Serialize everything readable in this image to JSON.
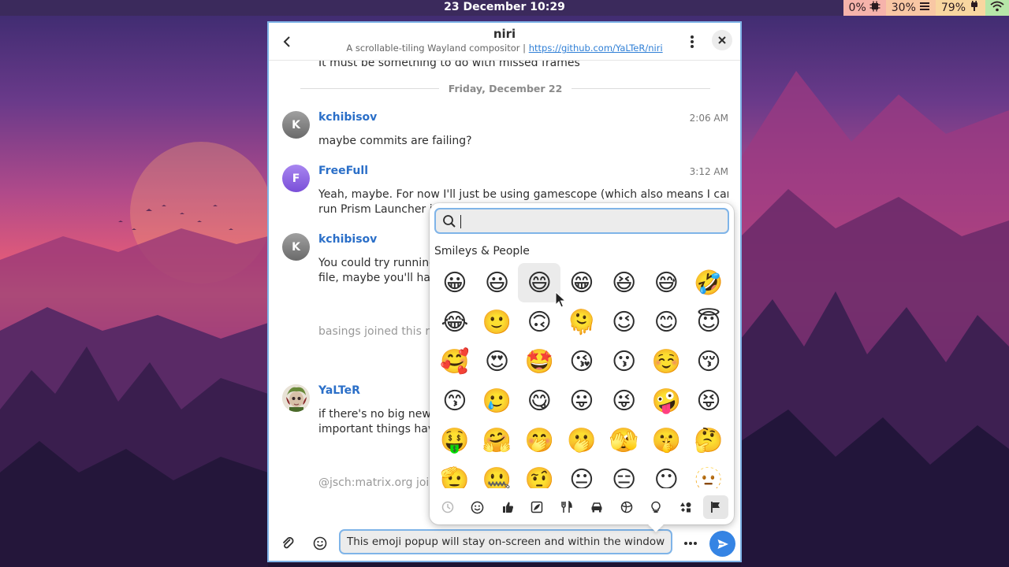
{
  "topbar": {
    "clock": "23 December 10:29",
    "cpu": "0%",
    "memory": "30%",
    "battery": "79%"
  },
  "room": {
    "title": "niri",
    "topic": "A scrollable-tiling Wayland compositor |",
    "topic_link": "https://github.com/YaLTeR/niri"
  },
  "timeline": {
    "prev_message": "It must be something to do with missed frames",
    "day_divider": "Friday, December 22",
    "messages": [
      {
        "sender": "kchibisov",
        "initial": "K",
        "time": "2:06 AM",
        "lines": [
          "maybe commits are failing?"
        ]
      },
      {
        "sender": "FreeFull",
        "initial": "F",
        "time": "3:12 AM",
        "lines": [
          "Yeah, maybe. For now I'll just be using gamescope (which also means I can just",
          "run Prism Launcher its"
        ]
      },
      {
        "sender": "kchibisov",
        "initial": "K",
        "time": "",
        "lines": [
          "You could try running r",
          "file, maybe you'll have"
        ]
      },
      {
        "sender": "YaLTeR",
        "initial": "",
        "time": "",
        "lines": [
          "if there's no big new is",
          "important things have"
        ]
      }
    ],
    "events": [
      "basings joined this roo",
      "@jsch:matrix.org joine"
    ]
  },
  "composer": {
    "value": "This emoji popup will stay on-screen and within the window!"
  },
  "emoji_picker": {
    "search_value": "",
    "section": "Smileys & People",
    "emojis": [
      "😀",
      "😃",
      "😄",
      "😁",
      "😆",
      "😅",
      "🤣",
      "😂",
      "🙂",
      "🙃",
      "🫠",
      "😉",
      "😊",
      "😇",
      "🥰",
      "😍",
      "🤩",
      "😘",
      "😗",
      "☺️",
      "😚",
      "😙",
      "🥲",
      "😋",
      "😛",
      "😜",
      "🤪",
      "😝",
      "🤑",
      "🤗",
      "🤭",
      "🫢",
      "🫣",
      "🤫",
      "🤔",
      "🫡",
      "🤐",
      "🤨",
      "😐",
      "😑",
      "😶",
      "🫥"
    ],
    "categories": [
      "recent-icon",
      "smileys-icon",
      "people-icon",
      "nature-icon",
      "food-icon",
      "travel-icon",
      "activities-icon",
      "objects-icon",
      "symbols-icon",
      "flags-icon"
    ]
  },
  "colors": {
    "accent": "#3584e4",
    "sender": "#2b6fc8",
    "window_border": "#7fb4e8"
  }
}
